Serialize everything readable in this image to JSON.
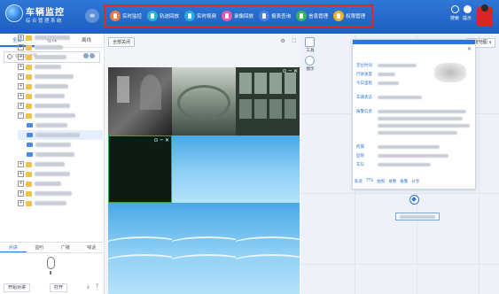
{
  "app": {
    "title": "车辆监控",
    "subtitle": "综合管理系统"
  },
  "nav": [
    {
      "label": "实时监控",
      "icon": "monitor-icon",
      "color": "#f07a3c"
    },
    {
      "label": "轨迹回放",
      "icon": "track-icon",
      "color": "#2bb2d6"
    },
    {
      "label": "实时视频",
      "icon": "video-icon",
      "color": "#2aa9e0"
    },
    {
      "label": "录像回放",
      "icon": "playback-icon",
      "color": "#ea5aa8"
    },
    {
      "label": "报表查询",
      "icon": "report-icon",
      "color": "#4a7fe0"
    },
    {
      "label": "信息管理",
      "icon": "info-icon",
      "color": "#34b35a"
    },
    {
      "label": "权限管理",
      "icon": "permission-icon",
      "color": "#f0b22b"
    }
  ],
  "header_right": {
    "search_label": "搜索",
    "tips_label": "提示"
  },
  "left": {
    "tabs": [
      "全部",
      "在线",
      "离线"
    ],
    "search_placeholder": "输入车牌号",
    "bottom_tabs": [
      "对讲",
      "监听",
      "广播",
      "喊话"
    ],
    "start_btn": "开始对讲",
    "open_btn": "打开"
  },
  "mid": {
    "close_all": "全部关闭"
  },
  "right": {
    "tool_labels": [
      "工具",
      "图示"
    ],
    "map_select": "百度地图 ∨",
    "card_fields": [
      "定位时间",
      "行驶速度",
      "今日里程",
      "车辆状态",
      "报警信息",
      "所属",
      "监管",
      "车队"
    ],
    "card_actions": [
      "轨迹",
      "TTS",
      "拍照",
      "录像",
      "报警",
      "分享"
    ]
  },
  "colors": {
    "header_blue": "#2f77d6",
    "highlight_red": "#e32626"
  }
}
